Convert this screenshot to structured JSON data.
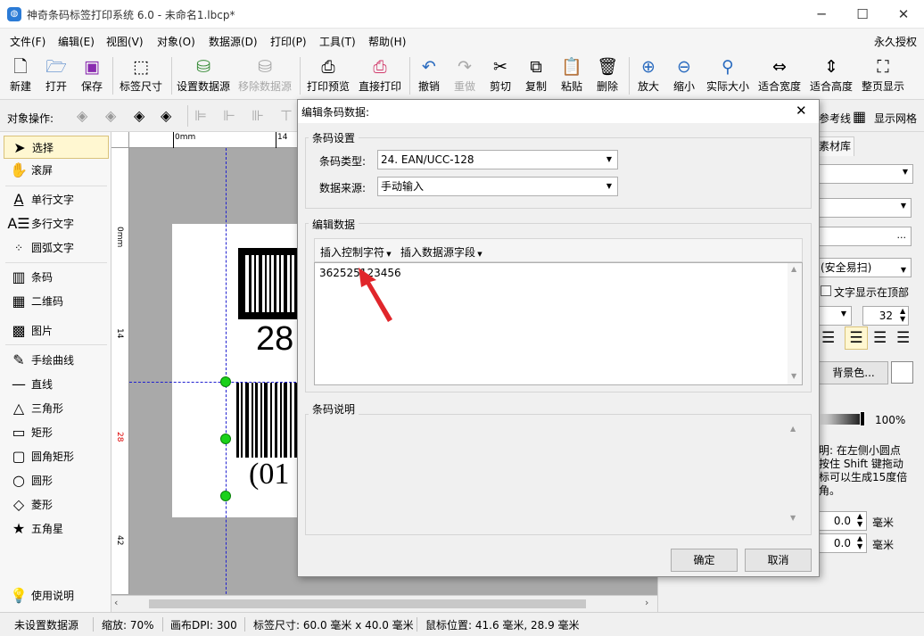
{
  "window": {
    "title": "神奇条码标签打印系统 6.0 - 未命名1.lbcp*",
    "app_icon": "app-logo-icon",
    "minimize": "─",
    "maximize": "☐",
    "close": "✕"
  },
  "menu": {
    "items": [
      "文件(F)",
      "编辑(E)",
      "视图(V)",
      "对象(O)",
      "数据源(D)",
      "打印(P)",
      "工具(T)",
      "帮助(H)"
    ],
    "license": "永久授权"
  },
  "toolbar": {
    "buttons": [
      "新建",
      "打开",
      "保存",
      "标签尺寸",
      "设置数据源",
      "移除数据源",
      "打印预览",
      "直接打印",
      "撤销",
      "重做",
      "剪切",
      "复制",
      "粘贴",
      "删除",
      "放大",
      "缩小",
      "实际大小",
      "适合宽度",
      "适合高度",
      "整页显示"
    ]
  },
  "objbar": {
    "label": "对象操作:",
    "ref_line": "参考线",
    "show_grid": "显示网格"
  },
  "tools": [
    {
      "label": "选择",
      "icon": "cursor-arrow-icon"
    },
    {
      "label": "滚屏",
      "icon": "hand-icon"
    },
    {
      "label": "单行文字",
      "icon": "single-line-text-icon"
    },
    {
      "label": "多行文字",
      "icon": "multi-line-text-icon"
    },
    {
      "label": "圆弧文字",
      "icon": "arc-text-icon"
    },
    {
      "label": "条码",
      "icon": "barcode-icon"
    },
    {
      "label": "二维码",
      "icon": "qrcode-icon"
    },
    {
      "label": "图片",
      "icon": "image-icon"
    },
    {
      "label": "手绘曲线",
      "icon": "pen-icon"
    },
    {
      "label": "直线",
      "icon": "line-icon"
    },
    {
      "label": "三角形",
      "icon": "triangle-icon"
    },
    {
      "label": "矩形",
      "icon": "rectangle-icon"
    },
    {
      "label": "圆角矩形",
      "icon": "rounded-rectangle-icon"
    },
    {
      "label": "圆形",
      "icon": "circle-icon"
    },
    {
      "label": "菱形",
      "icon": "diamond-icon"
    },
    {
      "label": "五角星",
      "icon": "star-icon"
    }
  ],
  "help_label": "使用说明",
  "ruler": {
    "h0": "0mm",
    "h14": "14",
    "v0": "0mm",
    "v14": "14",
    "v28": "28",
    "v42": "42"
  },
  "canvas": {
    "barcode1_text": "28",
    "barcode2_text": "(01"
  },
  "rightpanel": {
    "tab": "素材库",
    "barcode_type_hint": "(安全易扫)",
    "text_on_top": "文字显示在顶部",
    "font_size": "32",
    "bg_color_button": "背景色...",
    "opacity": "100%",
    "tip_lines": [
      "明: 在左侧小圆点",
      "按住 Shift 键拖动",
      "标可以生成15度倍",
      "角。"
    ],
    "val1": "0.0",
    "val2": "0.0",
    "unit": "毫米",
    "browse": "..."
  },
  "status": {
    "datasource": "未设置数据源",
    "zoom": "缩放: 70%",
    "dpi": "画布DPI: 300",
    "label_size": "标签尺寸: 60.0 毫米 x 40.0 毫米",
    "mouse": "鼠标位置: 41.6 毫米, 28.9 毫米"
  },
  "dialog": {
    "title": "编辑条码数据:",
    "close": "✕",
    "group1": "条码设置",
    "type_label": "条码类型:",
    "type_value": "24. EAN/UCC-128",
    "source_label": "数据来源:",
    "source_value": "手动输入",
    "group2": "编辑数据",
    "insert_ctrl": "插入控制字符",
    "insert_field": "插入数据源字段",
    "data_value": "362525123456",
    "group3": "条码说明",
    "ok": "确定",
    "cancel": "取消"
  },
  "colors": {
    "annotation_arrow": "#e0262b",
    "handle": "#1ad11a",
    "selected_tool": "#fff7d1"
  }
}
